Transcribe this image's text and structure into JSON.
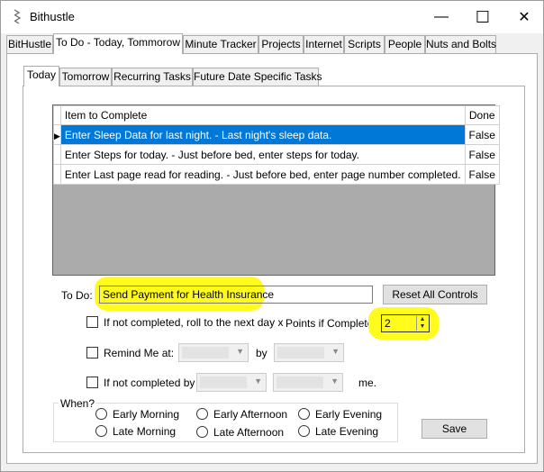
{
  "window": {
    "title": "Bithustle",
    "minimize": "—",
    "maximize": "☐",
    "close": "✕"
  },
  "main_tabs": [
    {
      "label": "BitHustle"
    },
    {
      "label": "To Do - Today, Tommorow"
    },
    {
      "label": "Minute Tracker"
    },
    {
      "label": "Projects"
    },
    {
      "label": "Internet"
    },
    {
      "label": "Scripts"
    },
    {
      "label": "People"
    },
    {
      "label": "Nuts and Bolts"
    }
  ],
  "sub_tabs": [
    {
      "label": "Today"
    },
    {
      "label": "Tomorrow"
    },
    {
      "label": "Recurring Tasks"
    },
    {
      "label": "Future Date Specific Tasks"
    }
  ],
  "grid": {
    "columns": [
      "Item to Complete",
      "Done"
    ],
    "rows": [
      {
        "item": "Enter Sleep Data for last night. - Last night's sleep data.",
        "done": "False"
      },
      {
        "item": "Enter Steps for today. - Just before bed, enter steps for today.",
        "done": "False"
      },
      {
        "item": "Enter Last page read for reading. - Just before bed, enter page number completed.",
        "done": "False"
      }
    ],
    "current_row_marker": "▶"
  },
  "todo": {
    "label": "To Do:",
    "value": "Send Payment for Health Insurance",
    "reset_label": "Reset All Controls"
  },
  "roll_over": {
    "label": "If not completed, roll to the next day x"
  },
  "points": {
    "label": "Points if Completed:",
    "value": "2"
  },
  "remind": {
    "label": "Remind Me at:",
    "by_label": "by"
  },
  "not_completed": {
    "label": "If not completed by",
    "suffix": "me."
  },
  "when": {
    "title": "When?",
    "options": [
      {
        "label": "Early Morning"
      },
      {
        "label": "Early Afternoon"
      },
      {
        "label": "Early Evening"
      },
      {
        "label": "Late Morning"
      },
      {
        "label": "Late Afternoon"
      },
      {
        "label": "Late Evening"
      }
    ]
  },
  "save_label": "Save",
  "colors": {
    "selection": "#0078d7",
    "highlight": "#fffb1c",
    "grid_background": "#ababab"
  },
  "icons": {
    "app": "app-icon",
    "current_row": "row-pointer-icon",
    "dropdown": "chevron-down-icon",
    "spinner": "spinner-arrows-icon"
  }
}
